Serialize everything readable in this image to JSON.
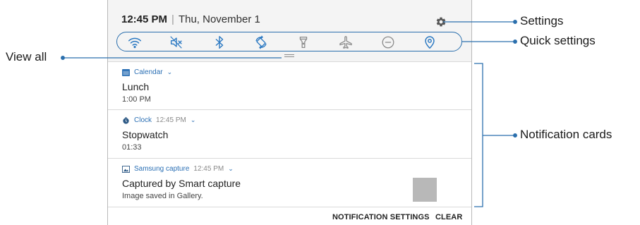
{
  "status_bar": {
    "time": "12:45 PM",
    "separator": "|",
    "date": "Thu, November 1"
  },
  "icons": {
    "settings": "gear-icon",
    "quick_settings": [
      "wifi-icon",
      "mute-icon",
      "bluetooth-icon",
      "auto-rotate-icon",
      "flashlight-icon",
      "airplane-mode-icon",
      "do-not-disturb-icon",
      "location-icon"
    ],
    "view_all": "drag-handle-icon"
  },
  "notifications": [
    {
      "app": "Calendar",
      "app_icon": "calendar-icon",
      "time": "",
      "title": "Lunch",
      "subtitle": "1:00 PM"
    },
    {
      "app": "Clock",
      "app_icon": "clock-icon",
      "time": "12:45 PM",
      "title": "Stopwatch",
      "subtitle": "01:33"
    },
    {
      "app": "Samsung capture",
      "app_icon": "image-icon",
      "time": "12:45 PM",
      "title": "Captured by Smart capture",
      "subtitle": "Image saved in Gallery."
    }
  ],
  "footer": {
    "notification_settings": "NOTIFICATION SETTINGS",
    "clear": "CLEAR"
  },
  "callouts": {
    "settings": "Settings",
    "quick_settings": "Quick settings",
    "view_all": "View all",
    "notification_cards": "Notification cards"
  },
  "colors": {
    "accent": "#2a6fb4",
    "callout_line": "#2b6fad"
  }
}
